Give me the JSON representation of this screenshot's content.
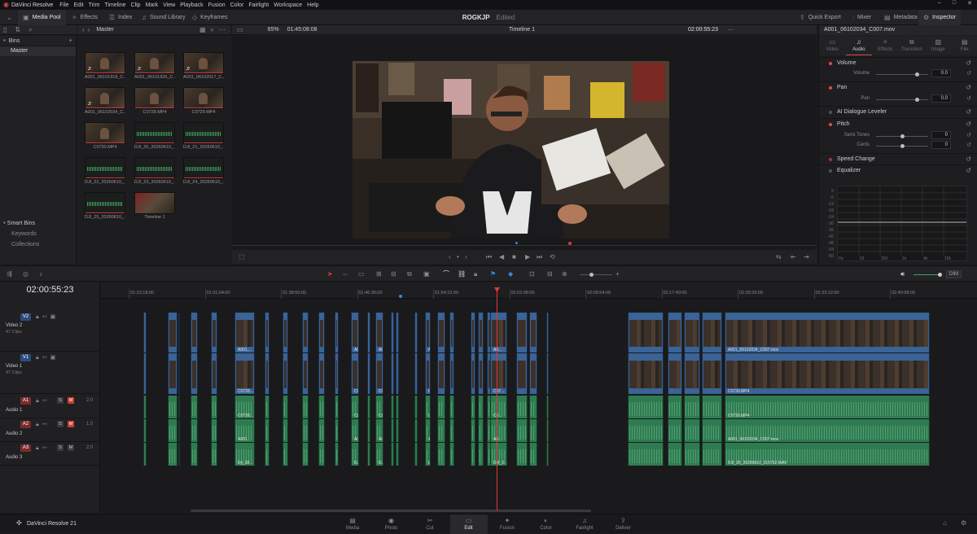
{
  "menubar": {
    "app_title": "DaVinci Resolve",
    "menus": [
      "File",
      "Edit",
      "Trim",
      "Timeline",
      "Clip",
      "Mark",
      "View",
      "Playback",
      "Fusion",
      "Color",
      "Fairlight",
      "Workspace",
      "Help"
    ],
    "window_controls": [
      "–",
      "□",
      "✕"
    ]
  },
  "toolbar": {
    "media_pool": "Media Pool",
    "effects": "Effects",
    "index": "Index",
    "sound_library": "Sound Library",
    "keyframes": "Keyframes",
    "project_name": "ROGKJP",
    "project_status": "Edited",
    "quick_export": "Quick Export",
    "mixer": "Mixer",
    "metadata": "Metadata",
    "inspector": "Inspector"
  },
  "media_pool": {
    "bins_label": "Bins",
    "master_header": "Master",
    "master_bin": "Master",
    "smart_bins": "Smart Bins",
    "keywords": "Keywords",
    "collections": "Collections",
    "clips": [
      {
        "name": "A001_06101919_C...",
        "kind": "vid",
        "note": "♬"
      },
      {
        "name": "A001_06101926_C...",
        "kind": "vid",
        "note": "♬"
      },
      {
        "name": "A001_06102017_C...",
        "kind": "vid",
        "note": "♬"
      },
      {
        "name": "A001_06102034_C...",
        "kind": "vid",
        "note": "♬"
      },
      {
        "name": "C0728.MP4",
        "kind": "vid",
        "note": ""
      },
      {
        "name": "C0729.MP4",
        "kind": "vid",
        "note": ""
      },
      {
        "name": "C0730.MP4",
        "kind": "vid",
        "note": ""
      },
      {
        "name": "DJI_20_20260610_...",
        "kind": "audio",
        "note": ""
      },
      {
        "name": "DJI_21_20260610_...",
        "kind": "audio",
        "note": ""
      },
      {
        "name": "DJI_22_20260610_...",
        "kind": "audio",
        "note": ""
      },
      {
        "name": "DJI_23_20260610_...",
        "kind": "audio",
        "note": ""
      },
      {
        "name": "DJI_24_20260610_...",
        "kind": "audio",
        "note": ""
      },
      {
        "name": "DJI_25_20260610_...",
        "kind": "audio",
        "note": ""
      },
      {
        "name": "Timeline 1",
        "kind": "tl",
        "note": ""
      }
    ]
  },
  "viewer": {
    "zoom": "65%",
    "source_timecode": "01:45:08:08",
    "timeline_name": "Timeline 1",
    "record_timecode": "02:00:55:23"
  },
  "inspector": {
    "clip_name": "A001_06102034_C007.mov",
    "tabs": [
      "Video",
      "Audio",
      "Effects",
      "Transition",
      "Image",
      "File"
    ],
    "sections": {
      "volume": "Volume",
      "volume_label": "Volume",
      "volume_value": "0.0",
      "pan": "Pan",
      "pan_label": "Pan",
      "pan_value": "0.0",
      "ai_dialogue": "AI Dialogue Leveler",
      "pitch": "Pitch",
      "semi_tones_label": "Semi Tones",
      "semi_tones_value": "0",
      "cents_label": "Cents",
      "cents_value": "0",
      "speed_change": "Speed Change",
      "equalizer": "Equalizer"
    },
    "eq_y_ticks": [
      "0",
      "-6",
      "-12",
      "-18",
      "-24",
      "-30",
      "-36",
      "-42",
      "-48",
      "-54",
      "-60"
    ],
    "eq_x_ticks": [
      "Hz",
      "63",
      "250",
      "1k",
      "4k",
      "16k"
    ]
  },
  "timeline": {
    "timecode": "02:00:55:23",
    "ruler_ticks": [
      "01:23:18:00",
      "01:31:04:00",
      "01:38:50:00",
      "01:46:36:00",
      "01:54:22:00",
      "02:02:08:00",
      "02:09:54:00",
      "02:17:40:00",
      "02:25:26:00",
      "02:33:12:00",
      "02:40:58:00"
    ],
    "dim_label": "DIM",
    "tracks": [
      {
        "tag": "V2",
        "name": "Video 2",
        "count": "47 Clips",
        "vol": ""
      },
      {
        "tag": "V1",
        "name": "Video 1",
        "count": "47 Clips",
        "vol": ""
      },
      {
        "tag": "A1",
        "name": "Audio 1",
        "count": "",
        "vol": "2.0"
      },
      {
        "tag": "A2",
        "name": "Audio 2",
        "count": "",
        "vol": "1.0"
      },
      {
        "tag": "A3",
        "name": "Audio 3",
        "count": "",
        "vol": "2.0"
      }
    ],
    "clip_labels": {
      "v2_a": "A001...",
      "v2_b": "A00...",
      "v2_c": "A00...",
      "v2_d": "A0...",
      "v2_e": "A...",
      "v2_f": "A0...",
      "v2_long": "A001_06102034_C007.mov",
      "v1_a": "C0728...",
      "v1_b": "C07...",
      "v1_c": "C07...",
      "v1_d": "C...",
      "v1_e": "C...",
      "v1_f": "C07...",
      "v1_long": "C0730.MP4",
      "a1_a": "C0728...",
      "a1_b": "C07...",
      "a1_c": "C07...",
      "a1_d": "C...",
      "a1_e": "C...",
      "a1_f": "C0...",
      "a1_long": "C0730.MP4",
      "a2_a": "A001...",
      "a2_b": "A00...",
      "a2_c": "A00...",
      "a2_d": "A0...",
      "a2_e": "A...",
      "a2_f": "A0...",
      "a2_long": "A001_06102034_C007.mov",
      "a3_a": "Dji_28...",
      "a3_b": "DJI_2...",
      "a3_c": "DJI...",
      "a3_d": "DJI_21...",
      "a3_e": "DJI_21...",
      "a3_f": "DJI_2...",
      "a3_long": "DJI_25_20260610_215752.WAV"
    }
  },
  "pages": {
    "brand": "DaVinci Resolve 21",
    "items": [
      "Media",
      "Photo",
      "Cut",
      "Edit",
      "Fusion",
      "Color",
      "Fairlight",
      "Deliver"
    ],
    "active": "Edit"
  },
  "colors": {
    "accent_red": "#e03a3a",
    "video_clip": "#3a6396",
    "audio_clip": "#2f7b51"
  }
}
